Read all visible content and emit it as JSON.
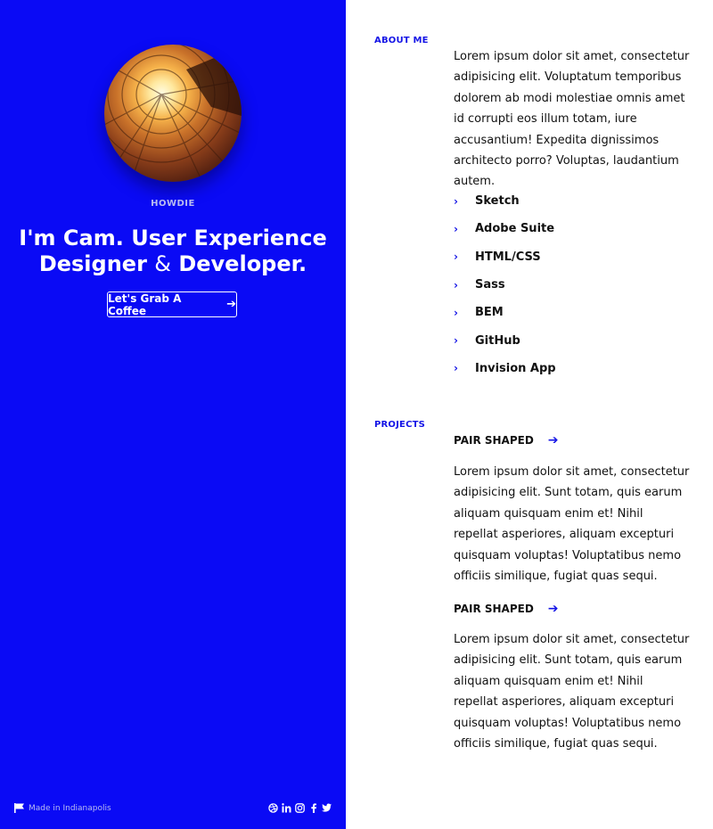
{
  "intro": {
    "eyebrow": "HOWDIE",
    "headline_part1": "I'm Cam. User Experience Designer ",
    "headline_amp": "&",
    "headline_part2": " Developer.",
    "cta_label": "Let's Grab A Coffee",
    "cta_arrow": "➔"
  },
  "footer": {
    "made_in": "Made in Indianapolis",
    "social_icons": [
      "dribbble-icon",
      "linkedin-icon",
      "instagram-icon",
      "facebook-icon",
      "twitter-icon"
    ]
  },
  "about": {
    "label": "ABOUT ME",
    "text": "Lorem ipsum dolor sit amet, consectetur adipisicing elit. Voluptatum temporibus dolorem ab modi molestiae omnis amet id corrupti eos illum totam, iure accusantium! Expedita dignissimos architecto porro? Voluptas, laudantium autem.",
    "skills": [
      "Sketch",
      "Adobe Suite",
      "HTML/CSS",
      "Sass",
      "BEM",
      "GitHub",
      "Invision App"
    ]
  },
  "projects": {
    "label": "PROJECTS",
    "items": [
      {
        "title": "PAIR SHAPED",
        "text": "Lorem ipsum dolor sit amet, consectetur adipisicing elit. Sunt totam, quis earum aliquam quisquam enim et! Nihil repellat asperiores, aliquam excepturi quisquam voluptas! Voluptatibus nemo officiis similique, fugiat quas sequi."
      },
      {
        "title": "PAIR SHAPED",
        "text": "Lorem ipsum dolor sit amet, consectetur adipisicing elit. Sunt totam, quis earum aliquam quisquam enim et! Nihil repellat asperiores, aliquam excepturi quisquam voluptas! Voluptatibus nemo officiis similique, fugiat quas sequi."
      }
    ]
  },
  "colors": {
    "panel_bg": "#0a0af5",
    "accent": "#1414e6",
    "text": "#111111"
  }
}
